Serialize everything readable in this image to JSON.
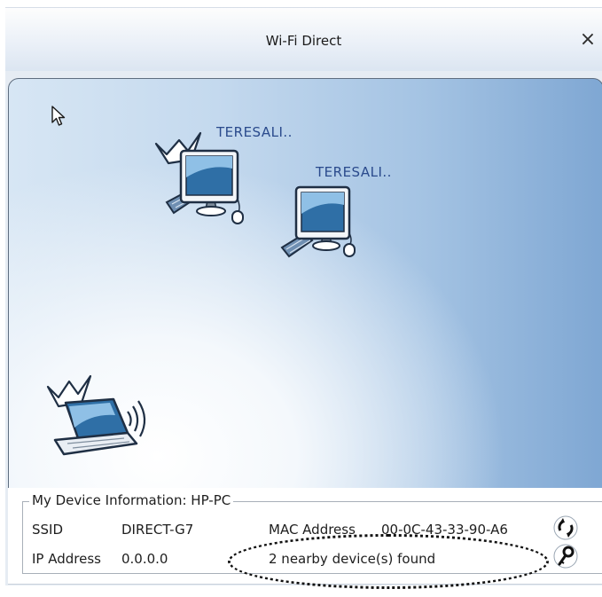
{
  "window": {
    "title": "Wi-Fi Direct",
    "close_label": "×"
  },
  "devices": [
    {
      "name": "TERESALI.."
    },
    {
      "name": "TERESALI.."
    }
  ],
  "my_device": {
    "legend": "My Device Information: HP-PC",
    "ssid_label": "SSID",
    "ssid_value": "DIRECT-G7",
    "mac_label": "MAC Address",
    "mac_value": "00-0C-43-33-90-A6",
    "ip_label": "IP Address",
    "ip_value": "0.0.0.0",
    "status": "2 nearby device(s) found"
  },
  "icons": {
    "refresh": "refresh-icon",
    "connect": "connect-icon",
    "cursor": "cursor-icon",
    "monitor": "desktop-computer-icon",
    "laptop": "laptop-wireless-icon"
  },
  "colors": {
    "device_label": "#2a4a8c",
    "background_right": "#7fa7d3",
    "background_left": "#d7e6f4"
  }
}
